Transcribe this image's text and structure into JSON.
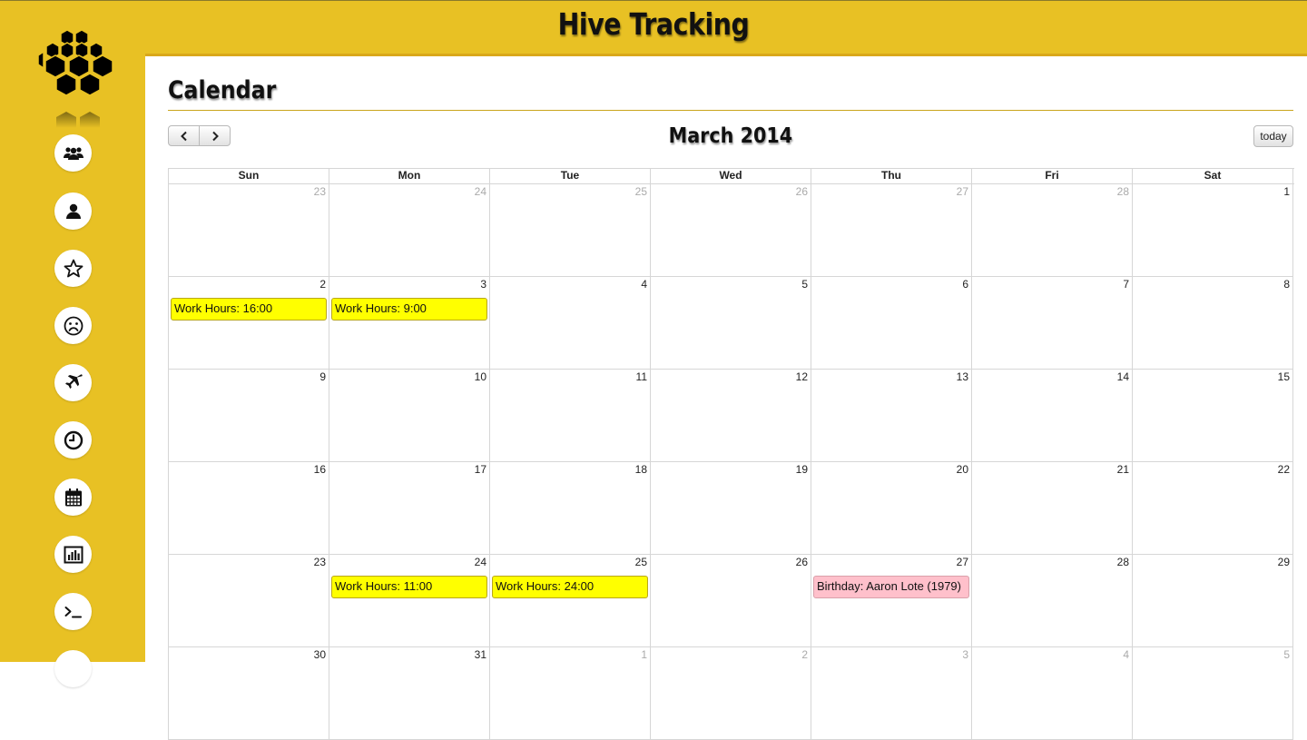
{
  "app": {
    "title": "Hive Tracking"
  },
  "sidebar": {
    "items": [
      {
        "name": "users-icon"
      },
      {
        "name": "user-icon"
      },
      {
        "name": "star-icon"
      },
      {
        "name": "frown-icon"
      },
      {
        "name": "plane-icon"
      },
      {
        "name": "clock-icon"
      },
      {
        "name": "calendar-icon"
      },
      {
        "name": "bar-chart-icon"
      },
      {
        "name": "terminal-icon"
      }
    ]
  },
  "page": {
    "title": "Calendar"
  },
  "calendar": {
    "month_title": "March 2014",
    "prev_label": "‹",
    "next_label": "›",
    "today_label": "today",
    "weekdays": [
      "Sun",
      "Mon",
      "Tue",
      "Wed",
      "Thu",
      "Fri",
      "Sat"
    ],
    "weeks": [
      [
        {
          "n": "23",
          "other": true
        },
        {
          "n": "24",
          "other": true
        },
        {
          "n": "25",
          "other": true
        },
        {
          "n": "26",
          "other": true
        },
        {
          "n": "27",
          "other": true
        },
        {
          "n": "28",
          "other": true
        },
        {
          "n": "1"
        }
      ],
      [
        {
          "n": "2",
          "event": {
            "text": "Work Hours: 16:00",
            "type": "work"
          }
        },
        {
          "n": "3",
          "event": {
            "text": "Work Hours: 9:00",
            "type": "work"
          }
        },
        {
          "n": "4"
        },
        {
          "n": "5"
        },
        {
          "n": "6"
        },
        {
          "n": "7"
        },
        {
          "n": "8"
        }
      ],
      [
        {
          "n": "9"
        },
        {
          "n": "10"
        },
        {
          "n": "11"
        },
        {
          "n": "12"
        },
        {
          "n": "13"
        },
        {
          "n": "14"
        },
        {
          "n": "15"
        }
      ],
      [
        {
          "n": "16"
        },
        {
          "n": "17"
        },
        {
          "n": "18"
        },
        {
          "n": "19"
        },
        {
          "n": "20"
        },
        {
          "n": "21"
        },
        {
          "n": "22"
        }
      ],
      [
        {
          "n": "23"
        },
        {
          "n": "24",
          "event": {
            "text": "Work Hours: 11:00",
            "type": "work"
          }
        },
        {
          "n": "25",
          "event": {
            "text": "Work Hours: 24:00",
            "type": "work"
          }
        },
        {
          "n": "26"
        },
        {
          "n": "27",
          "event": {
            "text": "Birthday: Aaron Lote (1979)",
            "type": "birthday"
          }
        },
        {
          "n": "28"
        },
        {
          "n": "29"
        }
      ],
      [
        {
          "n": "30"
        },
        {
          "n": "31"
        },
        {
          "n": "1",
          "other": true
        },
        {
          "n": "2",
          "other": true
        },
        {
          "n": "3",
          "other": true
        },
        {
          "n": "4",
          "other": true
        },
        {
          "n": "5",
          "other": true
        }
      ]
    ]
  },
  "colors": {
    "brand_yellow": "#e8c124",
    "work_event": "#ffff00",
    "birthday_event": "#ffc0cb"
  }
}
